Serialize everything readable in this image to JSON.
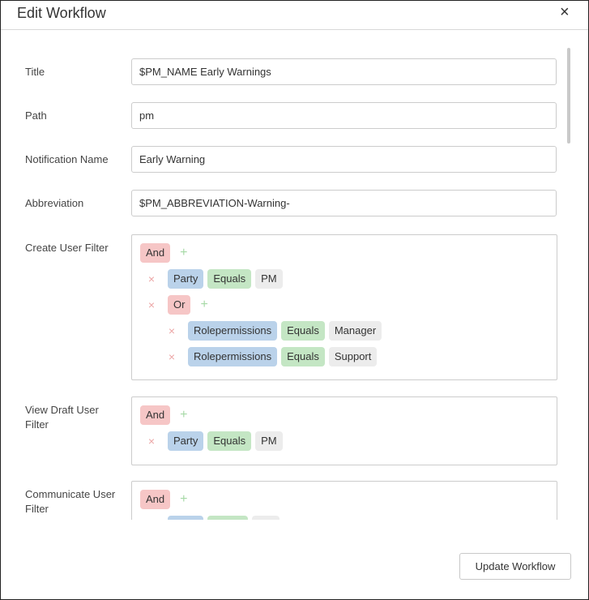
{
  "dialog": {
    "title": "Edit Workflow",
    "close_symbol": "×",
    "submit_label": "Update Workflow"
  },
  "fields": {
    "title": {
      "label": "Title",
      "value": "$PM_NAME Early Warnings"
    },
    "path": {
      "label": "Path",
      "value": "pm"
    },
    "notification_name": {
      "label": "Notification Name",
      "value": "Early Warning"
    },
    "abbreviation": {
      "label": "Abbreviation",
      "value": "$PM_ABBREVIATION-Warning-"
    }
  },
  "filters": {
    "create": {
      "label": "Create User Filter",
      "root_op": "And",
      "rule1": {
        "field": "Party",
        "cmp": "Equals",
        "value": "PM"
      },
      "group_op": "Or",
      "rule2": {
        "field": "Rolepermissions",
        "cmp": "Equals",
        "value": "Manager"
      },
      "rule3": {
        "field": "Rolepermissions",
        "cmp": "Equals",
        "value": "Support"
      }
    },
    "view_draft": {
      "label_line1": "View Draft User",
      "label_line2": "Filter",
      "root_op": "And",
      "rule1": {
        "field": "Party",
        "cmp": "Equals",
        "value": "PM"
      }
    },
    "communicate": {
      "label_line1": "Communicate User",
      "label_line2": "Filter",
      "root_op": "And"
    }
  },
  "icons": {
    "plus": "+",
    "remove": "×"
  },
  "colors": {
    "operator": "#f6c6c6",
    "field": "#bad2ea",
    "comparator": "#c4e6c4",
    "value": "#ececec",
    "plus": "#a6d9a6",
    "remove": "#eca6a6"
  }
}
